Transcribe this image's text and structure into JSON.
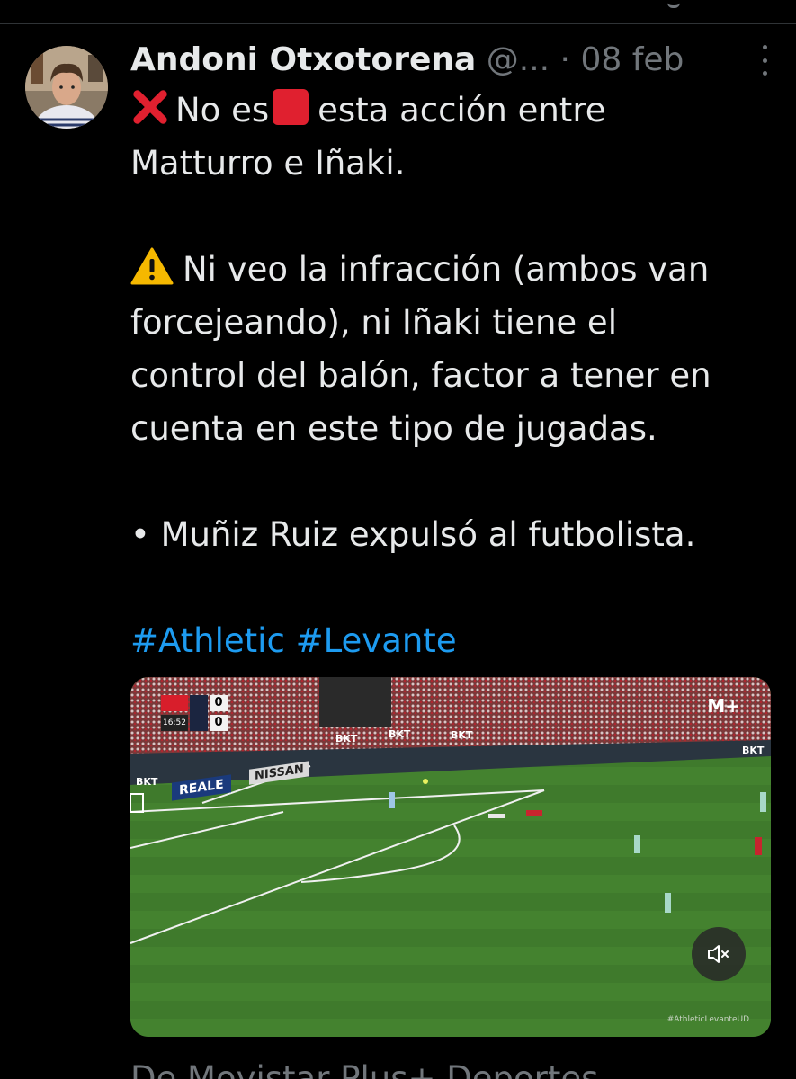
{
  "tweet": {
    "author_name": "Andoni Otxotorena",
    "handle": "@...",
    "separator": "·",
    "date": "08 feb",
    "line1_before": "No es",
    "line1_after": "esta acción entre",
    "line2": "Matturro e Iñaki.",
    "para2_lines": [
      "Ni veo la infracción (ambos van",
      "forcejeando), ni Iñaki tiene el",
      "control del balón, factor a tener en",
      "cuenta en este tipo de jugadas."
    ],
    "para3": "• Muñiz Ruiz expulsó al futbolista.",
    "hashtags": [
      "#Athletic",
      "#Levante"
    ]
  },
  "icons": {
    "x_mark": "cross-mark-icon",
    "red_card": "red-square-icon",
    "warning": "warning-icon",
    "more": "more-options-icon",
    "mute": "speaker-muted-icon"
  },
  "video": {
    "match_clock": "16:52",
    "home_score": "0",
    "away_score": "0",
    "broadcaster_logo": "M+",
    "ads": {
      "bkt": "BKT",
      "reale": "REALE",
      "nissan": "NISSAN"
    },
    "watermark": "#AthleticLevanteUD"
  },
  "source_attribution": "De Movistar Plus+ Deportes",
  "colors": {
    "background": "#000000",
    "text_primary": "#e7e9ea",
    "text_secondary": "#71767b",
    "link": "#1d9bf0",
    "red_card": "#e0202f"
  }
}
